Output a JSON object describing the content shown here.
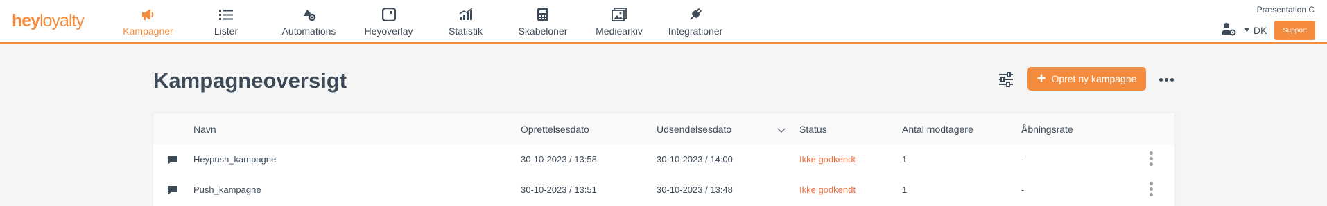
{
  "brand": {
    "logo_bold": "hey",
    "logo_thin": "loyalty",
    "accent": "#f58b3c"
  },
  "nav": {
    "items": [
      {
        "label": "Kampagner",
        "icon": "megaphone-icon",
        "active": true
      },
      {
        "label": "Lister",
        "icon": "list-icon",
        "active": false
      },
      {
        "label": "Automations",
        "icon": "automation-icon",
        "active": false
      },
      {
        "label": "Heyoverlay",
        "icon": "overlay-icon",
        "active": false
      },
      {
        "label": "Statistik",
        "icon": "stats-icon",
        "active": false
      },
      {
        "label": "Skabeloner",
        "icon": "template-icon",
        "active": false
      },
      {
        "label": "Mediearkiv",
        "icon": "media-icon",
        "active": false
      },
      {
        "label": "Integrationer",
        "icon": "plug-icon",
        "active": false
      }
    ]
  },
  "account": {
    "org_name": "Præsentation C",
    "language": "DK",
    "support_label": "Support"
  },
  "header": {
    "title": "Kampagneoversigt",
    "create_label": "Opret ny kampagne"
  },
  "table": {
    "columns": {
      "name": "Navn",
      "created": "Oprettelsesdato",
      "sent": "Udsendelsesdato",
      "status": "Status",
      "recipients": "Antal modtagere",
      "open_rate": "Åbningsrate"
    },
    "rows": [
      {
        "name": "Heypush_kampagne",
        "created": "30-10-2023 / 13:58",
        "sent": "30-10-2023 / 14:00",
        "status": "Ikke godkendt",
        "recipients": "1",
        "open_rate": "-"
      },
      {
        "name": "Push_kampagne",
        "created": "30-10-2023 / 13:51",
        "sent": "30-10-2023 / 13:48",
        "status": "Ikke godkendt",
        "recipients": "1",
        "open_rate": "-"
      }
    ]
  }
}
